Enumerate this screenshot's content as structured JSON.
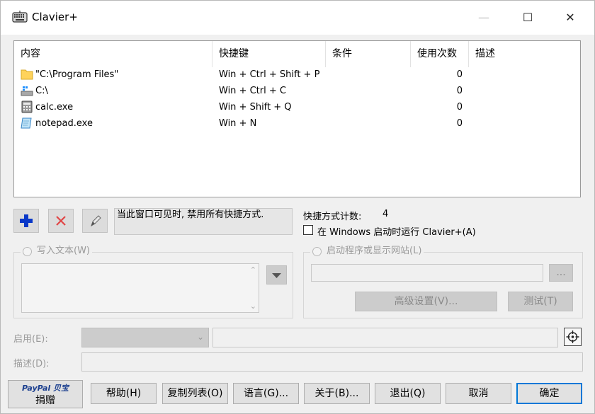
{
  "window": {
    "title": "Clavier+",
    "minimize": "—",
    "maximize": "☐",
    "close": "✕"
  },
  "list": {
    "columns": [
      "内容",
      "快捷键",
      "条件",
      "使用次数",
      "描述"
    ],
    "rows": [
      {
        "icon": "folder-icon",
        "content": "\"C:\\Program Files\"",
        "shortcut": "Win + Ctrl + Shift + P",
        "condition": "",
        "count": "0",
        "description": ""
      },
      {
        "icon": "drive-icon",
        "content": "C:\\",
        "shortcut": "Win + Ctrl + C",
        "condition": "",
        "count": "0",
        "description": ""
      },
      {
        "icon": "calculator-icon",
        "content": "calc.exe",
        "shortcut": "Win + Shift + Q",
        "condition": "",
        "count": "0",
        "description": ""
      },
      {
        "icon": "notepad-icon",
        "content": "notepad.exe",
        "shortcut": "Win + N",
        "condition": "",
        "count": "0",
        "description": ""
      }
    ]
  },
  "toolbar": {
    "add": "+",
    "delete": "✕",
    "edit": "✎"
  },
  "info_text": "当此窗口可见时, 禁用所有快捷方式.",
  "shortcut_count_label": "快捷方式计数:",
  "shortcut_count": "4",
  "startup_checkbox": "在 Windows 启动时运行 Clavier+(A)",
  "write_text_radio": "写入文本(W)",
  "launch_radio": "启动程序或显示网站(L)",
  "browse_button": "...",
  "advanced_button": "高级设置(V)...",
  "test_button": "测试(T)",
  "enable_label": "启用(E):",
  "description_label": "描述(D):",
  "bottom": {
    "paypal_brand": "PayPal 贝宝",
    "donate": "捐赠",
    "help": "帮助(H)",
    "copy_list": "复制列表(O)",
    "language": "语言(G)...",
    "about": "关于(B)...",
    "exit": "退出(Q)",
    "cancel": "取消",
    "ok": "确定"
  }
}
